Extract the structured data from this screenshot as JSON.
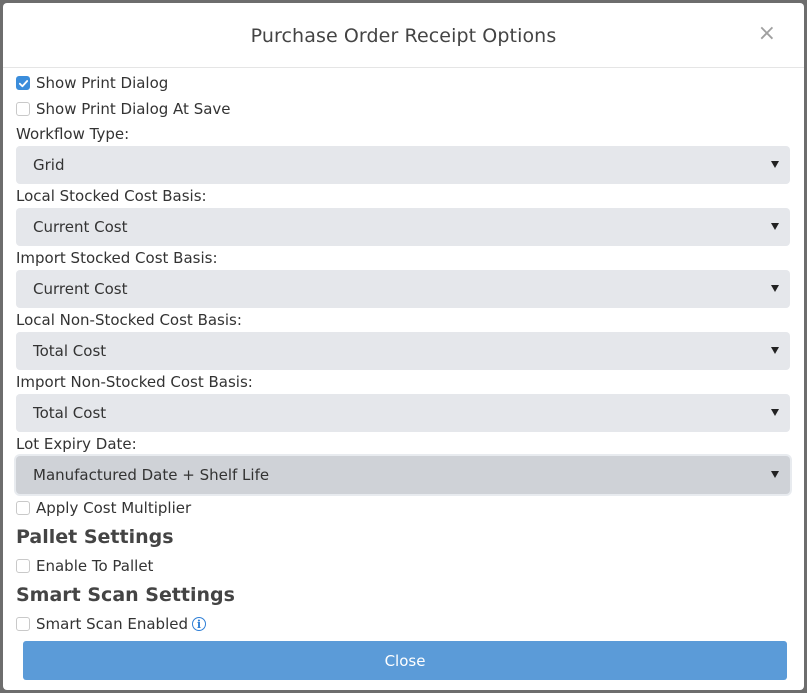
{
  "modal": {
    "title": "Purchase Order Receipt Options",
    "close_symbol": "×",
    "close_button_label": "Close"
  },
  "checkboxes": {
    "show_print_dialog": {
      "label": "Show Print Dialog",
      "checked": true
    },
    "show_print_dialog_at_save": {
      "label": "Show Print Dialog At Save",
      "checked": false
    },
    "apply_cost_multiplier": {
      "label": "Apply Cost Multiplier",
      "checked": false
    },
    "enable_to_pallet": {
      "label": "Enable To Pallet",
      "checked": false
    },
    "smart_scan_enabled": {
      "label": "Smart Scan Enabled",
      "checked": false
    }
  },
  "fields": {
    "workflow_type": {
      "label": "Workflow Type:",
      "value": "Grid"
    },
    "local_stocked_cost_basis": {
      "label": "Local Stocked Cost Basis:",
      "value": "Current Cost"
    },
    "import_stocked_cost_basis": {
      "label": "Import Stocked Cost Basis:",
      "value": "Current Cost"
    },
    "local_non_stocked_cost_basis": {
      "label": "Local Non-Stocked Cost Basis:",
      "value": "Total Cost"
    },
    "import_non_stocked_cost_basis": {
      "label": "Import Non-Stocked Cost Basis:",
      "value": "Total Cost"
    },
    "lot_expiry_date": {
      "label": "Lot Expiry Date:",
      "value": "Manufactured Date + Shelf Life"
    }
  },
  "sections": {
    "pallet_settings": "Pallet Settings",
    "smart_scan_settings": "Smart Scan Settings"
  },
  "icons": {
    "info": "i"
  },
  "colors": {
    "primary": "#5b9bd8",
    "checkbox_checked": "#3b8ddb",
    "select_bg": "#e5e7eb",
    "select_focused_bg": "#cfd2d7"
  }
}
